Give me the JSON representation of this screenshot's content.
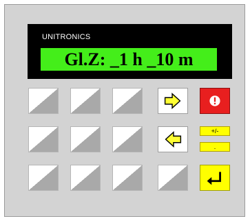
{
  "device": {
    "brand": "UNITRONICS",
    "lcd_text": "Gl.Z: _1 h _10 m"
  },
  "colors": {
    "panel": "#d3d3d3",
    "screen_frame": "#000000",
    "lcd_background": "#44ee1a",
    "alarm_key": "#e81f1f",
    "function_keys": "#ffff00"
  },
  "keys": {
    "blank_rows": 3,
    "arrow_right": "arrow-right-icon",
    "arrow_left": "arrow-left-icon",
    "alarm": "info-alert-icon",
    "plus_minus_label": "+/-",
    "decimal_label": ".",
    "enter": "enter-icon"
  }
}
